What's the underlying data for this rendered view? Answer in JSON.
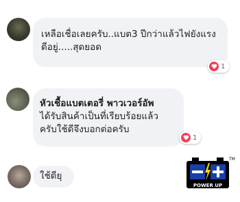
{
  "comments": [
    {
      "lines": [
        "เหลือเชื่อเลยครับ..แบต3 ปีกว่าแล้วไฟยังแรง",
        "ดีอยู่.....สุดยอด"
      ],
      "reaction_count": "1"
    },
    {
      "author": "หัวเชื้อแบตเตอรี่ พาวเวอร์อัพ",
      "lines": [
        "ได้รับสินค้าเป็นที่เรียบร้อยแล้ว",
        "ครับใช้ดีจึงบอกต่อครับ"
      ],
      "reaction_count": "1"
    },
    {
      "lines": [
        "ใช้ดียุ"
      ]
    }
  ],
  "logo": {
    "text": "POWER UP",
    "tm": "TM",
    "colors": {
      "battery": "#000000",
      "minus_panel": "#1a3fa8",
      "plus_panel": "#1a3fa8",
      "bolt": "#ffd400"
    }
  },
  "colors": {
    "bubble": "#f0f2f5",
    "heart": "#f33e58"
  }
}
